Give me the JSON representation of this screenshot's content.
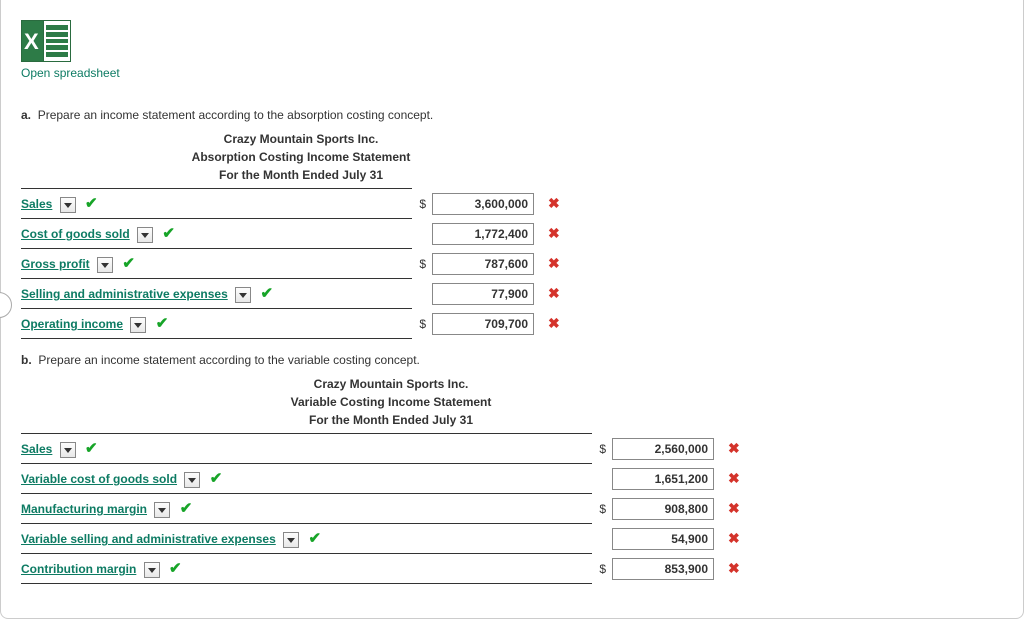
{
  "open_link": "Open spreadsheet",
  "partA": {
    "bullet": "a.",
    "prompt": "Prepare an income statement according to the absorption costing concept.",
    "company": "Crazy Mountain Sports Inc.",
    "title": "Absorption Costing Income Statement",
    "period": "For the Month Ended July 31",
    "rows": [
      {
        "label": "Sales",
        "dollar": "$",
        "value": "3,600,000",
        "mark": "x"
      },
      {
        "label": "Cost of goods sold",
        "dollar": "",
        "value": "1,772,400",
        "mark": "x"
      },
      {
        "label": "Gross profit",
        "dollar": "$",
        "value": "787,600",
        "mark": "x"
      },
      {
        "label": "Selling and administrative expenses",
        "dollar": "",
        "value": "77,900",
        "mark": "x"
      },
      {
        "label": "Operating income",
        "dollar": "$",
        "value": "709,700",
        "mark": "x"
      }
    ]
  },
  "partB": {
    "bullet": "b.",
    "prompt": "Prepare an income statement according to the variable costing concept.",
    "company": "Crazy Mountain Sports Inc.",
    "title": "Variable Costing Income Statement",
    "period": "For the Month Ended July 31",
    "rows": [
      {
        "label": "Sales",
        "dollar": "$",
        "value": "2,560,000",
        "mark": "x"
      },
      {
        "label": "Variable cost of goods sold",
        "dollar": "",
        "value": "1,651,200",
        "mark": "x"
      },
      {
        "label": "Manufacturing margin",
        "dollar": "$",
        "value": "908,800",
        "mark": "x"
      },
      {
        "label": "Variable selling and administrative expenses",
        "dollar": "",
        "value": "54,900",
        "mark": "x"
      },
      {
        "label": "Contribution margin",
        "dollar": "$",
        "value": "853,900",
        "mark": "x"
      }
    ]
  }
}
